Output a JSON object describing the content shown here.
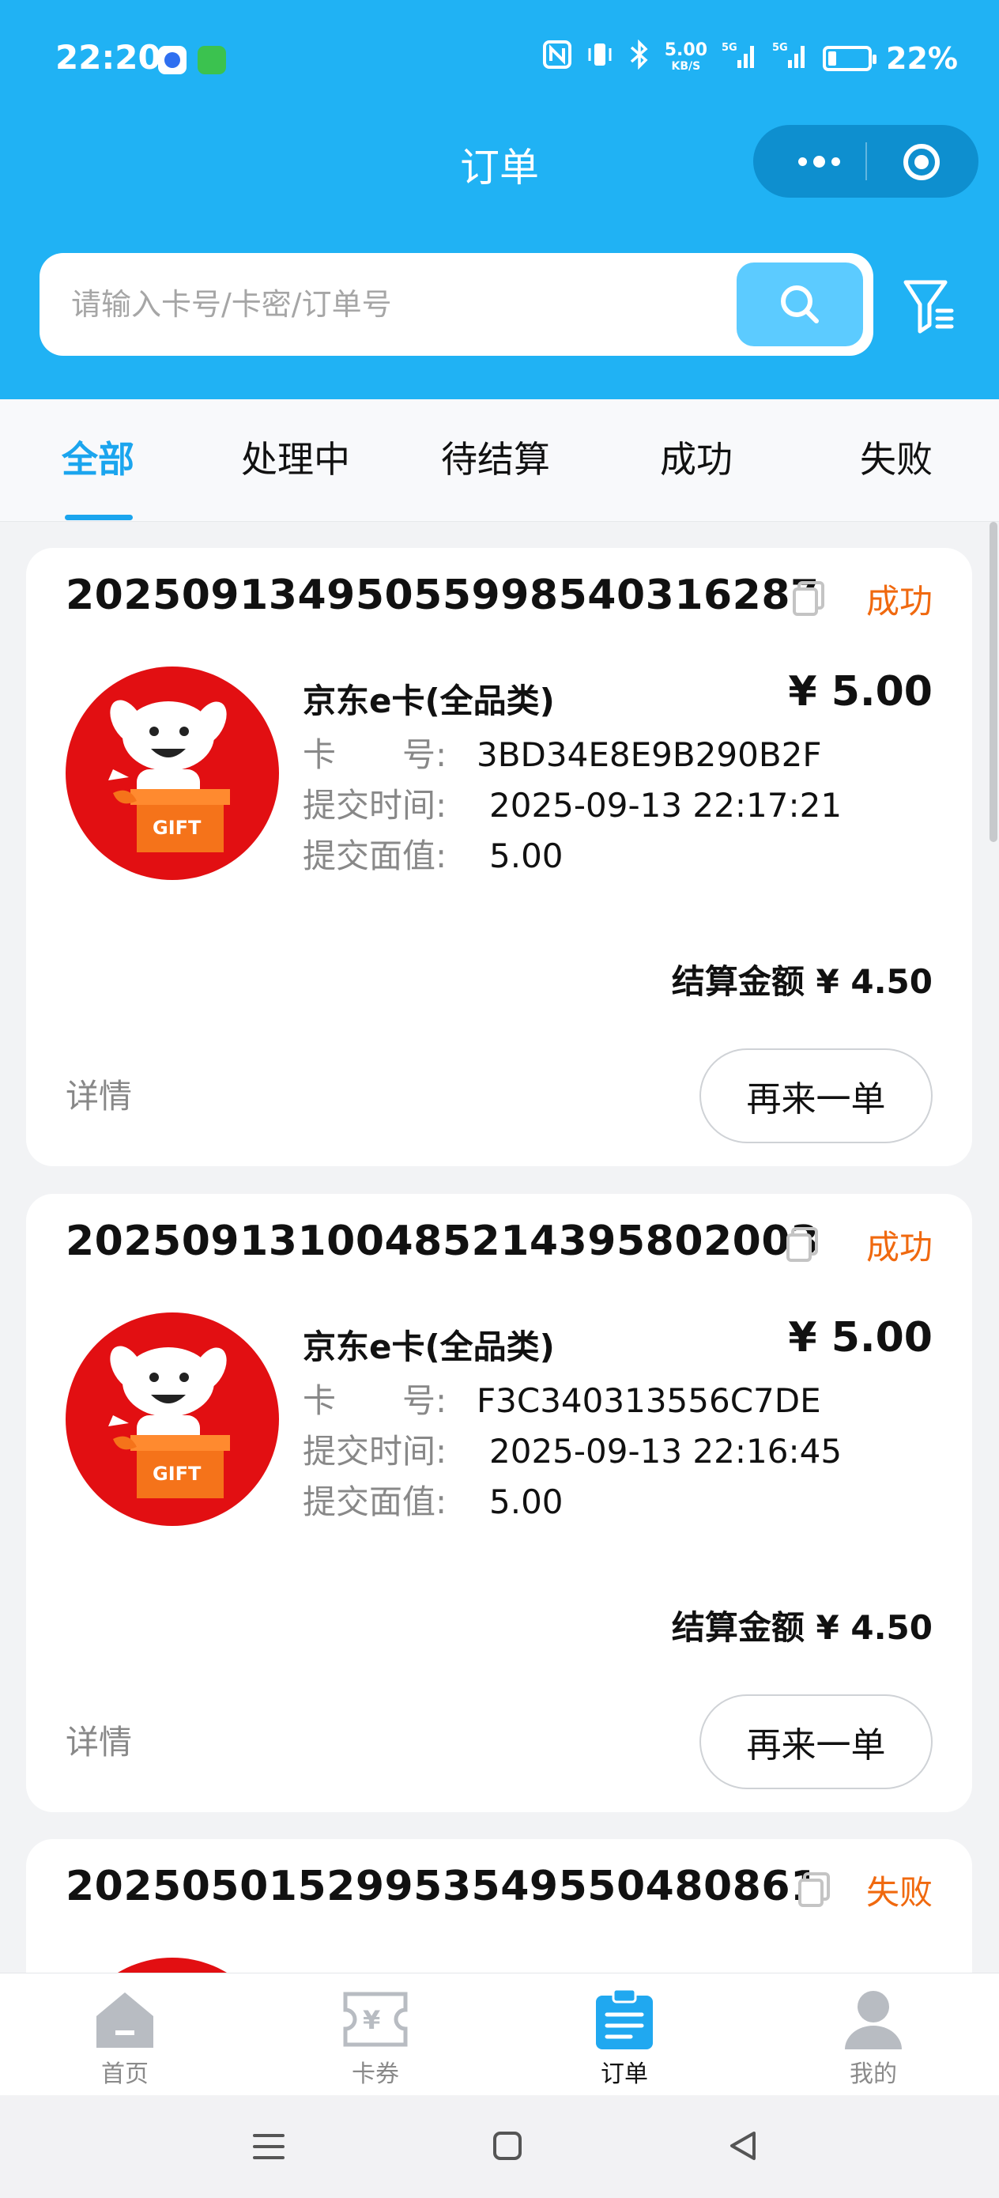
{
  "status_bar": {
    "time": "22:20",
    "speed_value": "5.00",
    "speed_unit": "KB/S",
    "battery": "22%",
    "icons": [
      "nfc-icon",
      "vibrate-icon",
      "bluetooth-icon",
      "signal-5g-icon",
      "signal-5g-icon",
      "battery-icon"
    ]
  },
  "header": {
    "title": "订单",
    "search_placeholder": "请输入卡号/卡密/订单号"
  },
  "tabs": [
    {
      "label": "全部",
      "active": true
    },
    {
      "label": "处理中",
      "active": false
    },
    {
      "label": "待结算",
      "active": false
    },
    {
      "label": "成功",
      "active": false
    },
    {
      "label": "失败",
      "active": false
    }
  ],
  "orders": [
    {
      "order_no": "20250913495055998540316287",
      "status": "成功",
      "product_name": "京东e卡(全品类)",
      "price": "¥ 5.00",
      "card_label": "卡　　号:",
      "card_no": "3BD34E8E9B290B2F",
      "time_label": "提交时间:",
      "submit_time": "2025-09-13 22:17:21",
      "face_label": "提交面值:",
      "face_value": "5.00",
      "settle": "结算金额 ¥ 4.50",
      "detail_label": "详情",
      "again_label": "再来一单"
    },
    {
      "order_no": "20250913100485214395802003",
      "status": "成功",
      "product_name": "京东e卡(全品类)",
      "price": "¥ 5.00",
      "card_label": "卡　　号:",
      "card_no": "F3C340313556C7DE",
      "time_label": "提交时间:",
      "submit_time": "2025-09-13 22:16:45",
      "face_label": "提交面值:",
      "face_value": "5.00",
      "settle": "结算金额 ¥ 4.50",
      "detail_label": "详情",
      "again_label": "再来一单"
    },
    {
      "order_no": "20250501529953549550480861",
      "status": "失败"
    }
  ],
  "product_image_text": "GIFT",
  "bottom_nav": [
    {
      "label": "首页",
      "icon": "home-icon",
      "active": false
    },
    {
      "label": "卡券",
      "icon": "coupon-icon",
      "active": false
    },
    {
      "label": "订单",
      "icon": "order-icon",
      "active": true
    },
    {
      "label": "我的",
      "icon": "user-icon",
      "active": false
    }
  ],
  "colors": {
    "header_bg": "#20b2f4",
    "accent": "#1ba5ee",
    "status_text": "#f0690f"
  }
}
